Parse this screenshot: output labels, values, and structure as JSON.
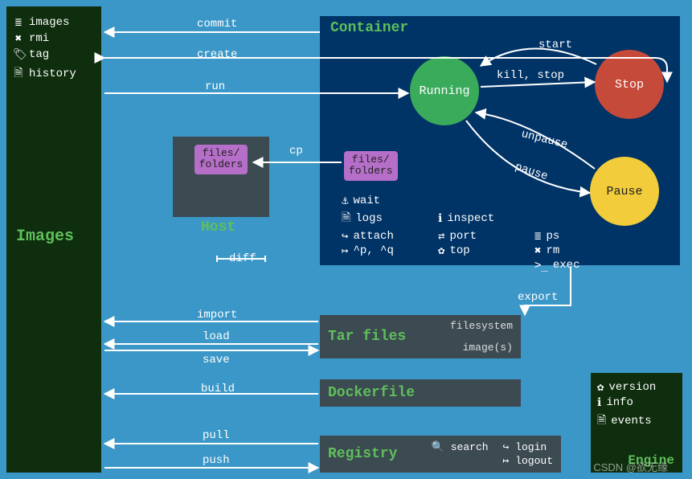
{
  "sidebar": {
    "title": "Images",
    "items": [
      {
        "icon": "≣",
        "label": "images"
      },
      {
        "icon": "✖",
        "label": "rmi"
      },
      {
        "icon": "🏷",
        "label": "tag"
      },
      {
        "icon": "🗎",
        "label": "history"
      }
    ]
  },
  "container": {
    "title": "Container",
    "states": {
      "running": "Running",
      "stop": "Stop",
      "pause": "Pause"
    },
    "transitions": {
      "start": "start",
      "kill_stop": "kill, stop",
      "pause": "pause",
      "unpause": "unpause"
    },
    "files_folders": "files/\nfolders",
    "commands": [
      {
        "icon": "⚓",
        "label": "wait"
      },
      {
        "icon": "🗎",
        "label": "logs"
      },
      {
        "icon": "ℹ",
        "label": "inspect"
      },
      {
        "icon": "↪",
        "label": "attach"
      },
      {
        "icon": "⇄",
        "label": "port"
      },
      {
        "icon": "≣",
        "label": "ps"
      },
      {
        "icon": "↦",
        "label": "^p, ^q"
      },
      {
        "icon": "✿",
        "label": "top"
      },
      {
        "icon": "✖",
        "label": "rm"
      },
      {
        "icon": ">_",
        "label": "exec"
      }
    ]
  },
  "host": {
    "title": "Host",
    "files_folders": "files/\nfolders"
  },
  "arrows": {
    "commit": "commit",
    "create": "create",
    "run": "run",
    "cp": "cp",
    "diff": "diff",
    "export": "export",
    "import": "import",
    "load": "load",
    "save": "save",
    "build": "build",
    "pull": "pull",
    "push": "push"
  },
  "tar": {
    "title": "Tar files",
    "sub1": "filesystem",
    "sub2": "image(s)"
  },
  "dockerfile": {
    "title": "Dockerfile"
  },
  "registry": {
    "title": "Registry",
    "commands": [
      {
        "icon": "🔍",
        "label": "search"
      },
      {
        "icon": "↪",
        "label": "login"
      },
      {
        "icon": "↦",
        "label": "logout"
      }
    ]
  },
  "engine": {
    "title": "Engine",
    "items": [
      {
        "icon": "✿",
        "label": "version"
      },
      {
        "icon": "ℹ",
        "label": "info"
      },
      {
        "icon": "🗎",
        "label": "events"
      }
    ]
  },
  "watermark": "CSDN @欲无缘"
}
